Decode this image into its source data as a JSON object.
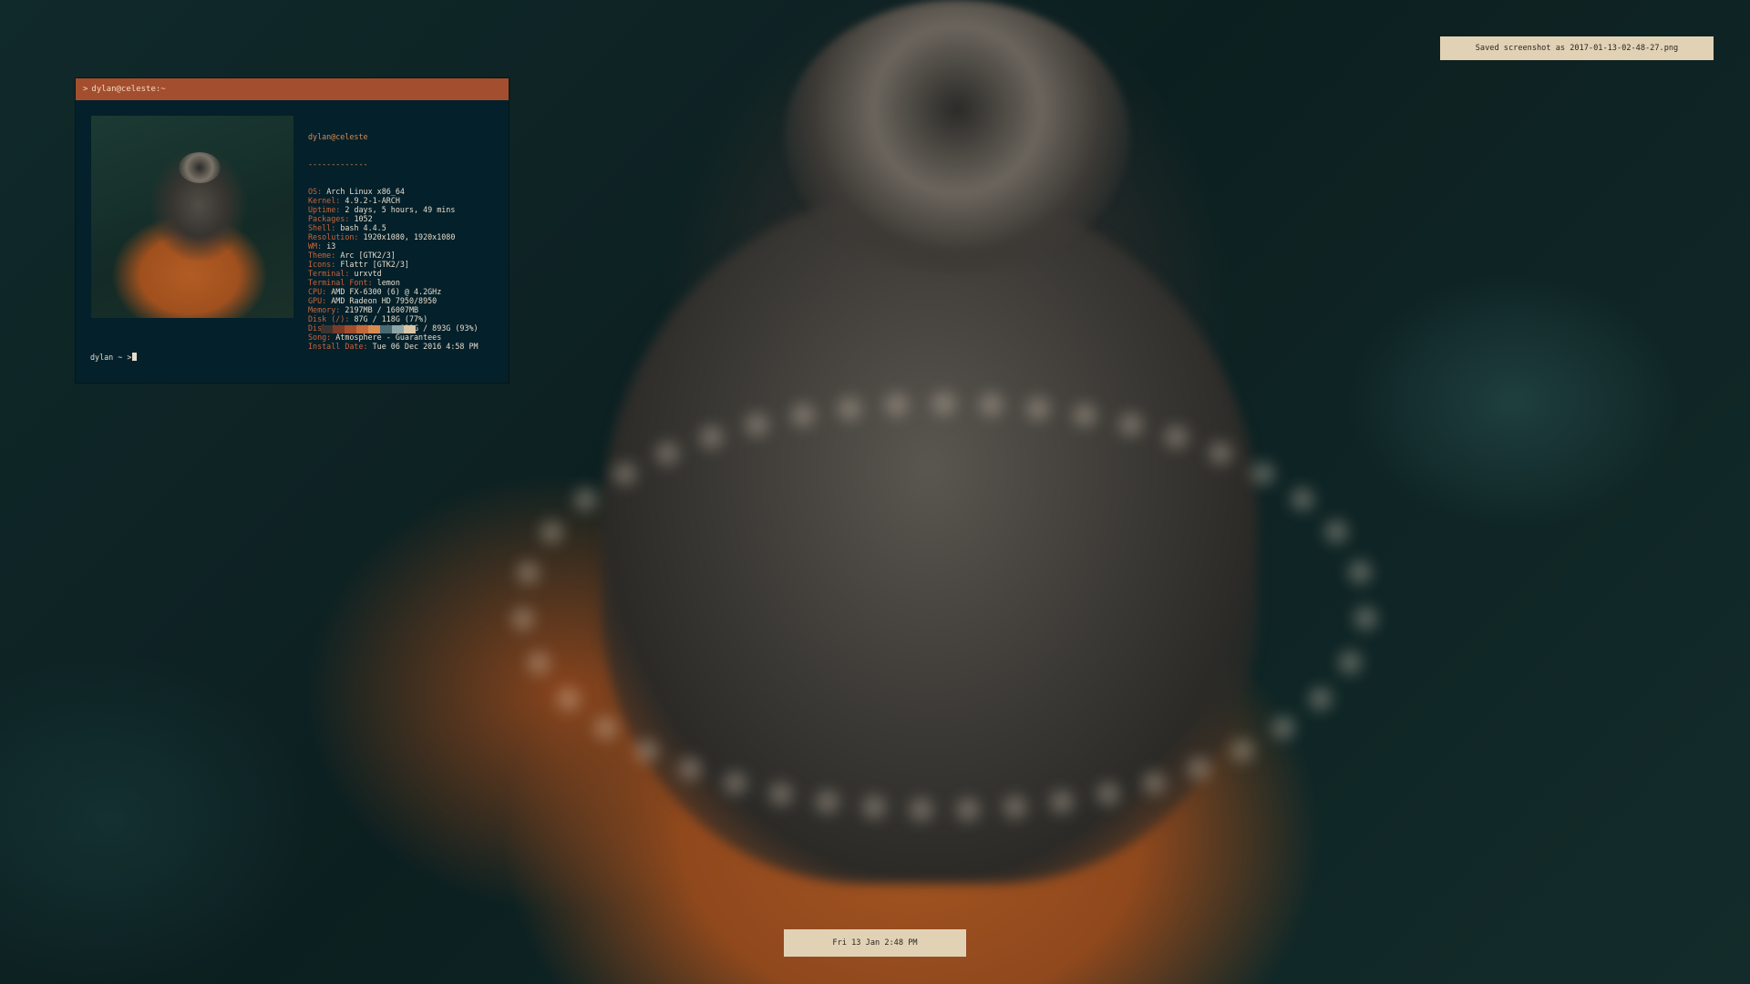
{
  "terminal": {
    "title": "dylan@celeste:~",
    "title_glyph": ">",
    "header_user": "dylan@celeste",
    "header_rule": "-------------",
    "info": [
      {
        "key": "OS",
        "value": "Arch Linux x86_64"
      },
      {
        "key": "Kernel",
        "value": "4.9.2-1-ARCH"
      },
      {
        "key": "Uptime",
        "value": "2 days, 5 hours, 49 mins"
      },
      {
        "key": "Packages",
        "value": "1052"
      },
      {
        "key": "Shell",
        "value": "bash 4.4.5"
      },
      {
        "key": "Resolution",
        "value": "1920x1080, 1920x1080"
      },
      {
        "key": "WM",
        "value": "i3"
      },
      {
        "key": "Theme",
        "value": "Arc [GTK2/3]"
      },
      {
        "key": "Icons",
        "value": "Flattr [GTK2/3]"
      },
      {
        "key": "Terminal",
        "value": "urxvtd"
      },
      {
        "key": "Terminal Font",
        "value": "lemon"
      },
      {
        "key": "CPU",
        "value": "AMD FX-6300 (6) @ 4.2GHz"
      },
      {
        "key": "GPU",
        "value": "AMD Radeon HD 7950/8950"
      },
      {
        "key": "Memory",
        "value": "2197MB / 16007MB"
      },
      {
        "key": "Disk (/)",
        "value": "87G / 118G (77%)"
      },
      {
        "key": "Disk (/mnt/Videos)",
        "value": "823G / 893G (93%)"
      },
      {
        "key": "Song",
        "value": "Atmosphere - Guarantees"
      },
      {
        "key": "Install Date",
        "value": "Tue 06 Dec 2016 4:58 PM"
      }
    ],
    "palette": [
      "#3b3431",
      "#7a3b28",
      "#a34e2e",
      "#c46a3a",
      "#d98a50",
      "#4a6a74",
      "#8fa6a6",
      "#d8c6a6"
    ],
    "prompt": "dylan ~ >"
  },
  "notification": {
    "text": "Saved screenshot as 2017-01-13-02-48-27.png"
  },
  "clock": {
    "text": "Fri 13 Jan  2:48 PM"
  },
  "colors": {
    "titlebar": "#a34e2e",
    "terminal_bg": "#04202a",
    "bar_bg": "#e1d2b6",
    "accent": "#d98a50"
  }
}
